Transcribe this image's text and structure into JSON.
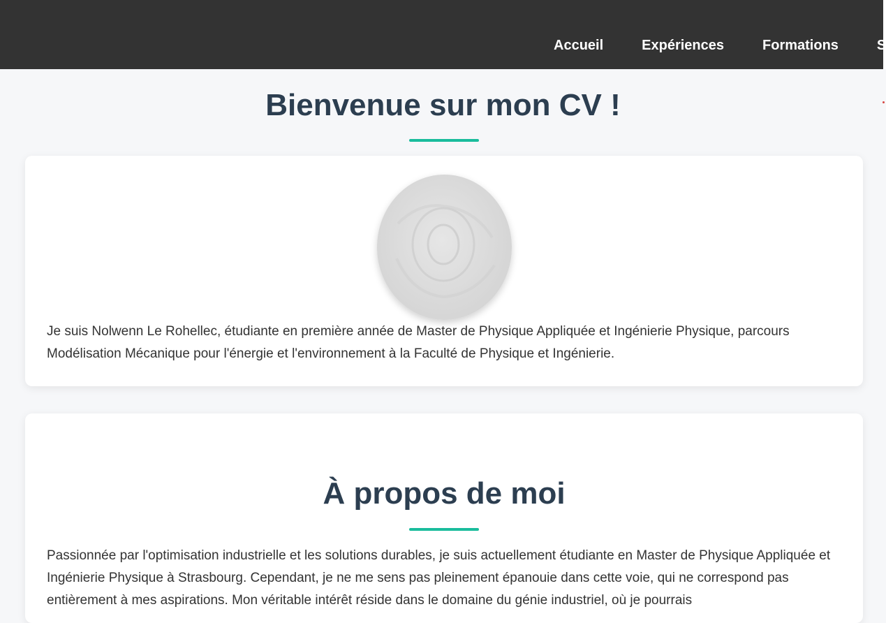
{
  "nav": {
    "items": [
      "Accueil",
      "Expériences",
      "Formations",
      "S"
    ]
  },
  "header": {
    "title": "Bienvenue sur mon CV !"
  },
  "intro": {
    "text": "Je suis Nolwenn Le Rohellec, étudiante en première année de Master de Physique Appliquée et Ingénierie Physique, parcours Modélisation Mécanique pour l'énergie et l'environnement à la Faculté de Physique et Ingénierie."
  },
  "about": {
    "title": "À propos de moi",
    "text": "Passionnée par l'optimisation industrielle et les solutions durables, je suis actuellement étudiante en Master de Physique Appliquée et Ingénierie Physique à Strasbourg. Cependant, je ne me sens pas pleinement épanouie dans cette voie, qui ne correspond pas entièrement à mes aspirations. Mon véritable intérêt réside dans le domaine du génie industriel, où je pourrais"
  },
  "colors": {
    "header_bg": "#333333",
    "accent": "#1abc9c",
    "heading": "#2c3e50",
    "page_bg": "#f6f7f9"
  }
}
